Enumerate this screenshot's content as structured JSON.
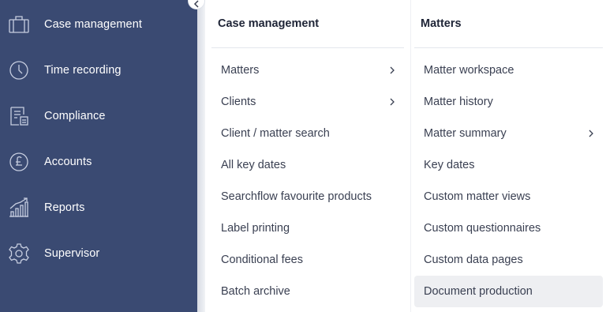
{
  "colors": {
    "nav_bg": "#3a4a72",
    "nav_text": "#ffffff",
    "panel_text": "#3a4052",
    "panel_title": "#1e2436",
    "active_row": "#eeeff2"
  },
  "nav": {
    "items": [
      {
        "label": "Case management",
        "icon": "briefcase-icon"
      },
      {
        "label": "Time recording",
        "icon": "clock-icon"
      },
      {
        "label": "Compliance",
        "icon": "compliance-document-icon"
      },
      {
        "label": "Accounts",
        "icon": "pound-icon"
      },
      {
        "label": "Reports",
        "icon": "bar-chart-icon"
      },
      {
        "label": "Supervisor",
        "icon": "gear-icon"
      }
    ]
  },
  "panel1": {
    "title": "Case management",
    "items": [
      {
        "label": "Matters",
        "has_submenu": true
      },
      {
        "label": "Clients",
        "has_submenu": true
      },
      {
        "label": "Client / matter search",
        "has_submenu": false
      },
      {
        "label": "All key dates",
        "has_submenu": false
      },
      {
        "label": "Searchflow favourite products",
        "has_submenu": false
      },
      {
        "label": "Label printing",
        "has_submenu": false
      },
      {
        "label": "Conditional fees",
        "has_submenu": false
      },
      {
        "label": "Batch archive",
        "has_submenu": false
      }
    ]
  },
  "panel2": {
    "title": "Matters",
    "items": [
      {
        "label": "Matter workspace",
        "has_submenu": false
      },
      {
        "label": "Matter history",
        "has_submenu": false
      },
      {
        "label": "Matter summary",
        "has_submenu": true
      },
      {
        "label": "Key dates",
        "has_submenu": false
      },
      {
        "label": "Custom matter views",
        "has_submenu": false
      },
      {
        "label": "Custom questionnaires",
        "has_submenu": false
      },
      {
        "label": "Custom data pages",
        "has_submenu": false
      },
      {
        "label": "Document production",
        "has_submenu": false,
        "highlighted": true
      }
    ]
  }
}
